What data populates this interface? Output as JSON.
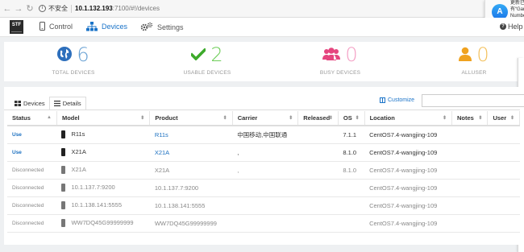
{
  "browser": {
    "info": "i",
    "insecure_label": "不安全",
    "host": "10.1.132.193",
    "path": ":7100/#!/devices"
  },
  "notification": {
    "lines": [
      "更新已",
      "有“Gar",
      "Numbe"
    ]
  },
  "header": {
    "logo": "STF",
    "nav": {
      "control": "Control",
      "devices": "Devices",
      "settings": "Settings"
    },
    "help": "Help"
  },
  "stats": {
    "total": {
      "value": "6",
      "label": "TOTAL DEVICES"
    },
    "usable": {
      "value": "2",
      "label": "USABLE DEVICES"
    },
    "busy": {
      "value": "0",
      "label": "BUSY DEVICES"
    },
    "alluser": {
      "value": "0",
      "label": "ALLUSER"
    }
  },
  "device_panel": {
    "tabs": {
      "devices": "Devices",
      "details": "Details"
    },
    "customize": "Customize",
    "search_placeholder": ""
  },
  "table": {
    "columns": [
      "Status",
      "Model",
      "Product",
      "Carrier",
      "Released",
      "OS",
      "Location",
      "Notes",
      "User"
    ],
    "rows": [
      {
        "status": "Use",
        "model": "R11s",
        "product": "R11s",
        "carrier": "中国移动,中国联通",
        "released": "",
        "os": "7.1.1",
        "location": "CentOS7.4-wangjing-109",
        "notes": "",
        "user": ""
      },
      {
        "status": "Use",
        "model": "X21A",
        "product": "X21A",
        "carrier": ",",
        "released": "",
        "os": "8.1.0",
        "location": "CentOS7.4-wangjing-109",
        "notes": "",
        "user": ""
      },
      {
        "status": "Disconnected",
        "model": "X21A",
        "product": "X21A",
        "carrier": ",",
        "released": "",
        "os": "8.1.0",
        "location": "CentOS7.4-wangjing-109",
        "notes": "",
        "user": ""
      },
      {
        "status": "Disconnected",
        "model": "10.1.137.7:9200",
        "product": "10.1.137.7:9200",
        "carrier": "",
        "released": "",
        "os": "",
        "location": "CentOS7.4-wangjing-109",
        "notes": "",
        "user": ""
      },
      {
        "status": "Disconnected",
        "model": "10.1.138.141:5555",
        "product": "10.1.138.141:5555",
        "carrier": "",
        "released": "",
        "os": "",
        "location": "CentOS7.4-wangjing-109",
        "notes": "",
        "user": ""
      },
      {
        "status": "Disconnected",
        "model": "WW7DQ45G99999999",
        "product": "WW7DQ45G99999999",
        "carrier": "",
        "released": "",
        "os": "",
        "location": "CentOS7.4-wangjing-109",
        "notes": "",
        "user": ""
      }
    ]
  },
  "colors": {
    "accent": "#1a73c8",
    "total": "#6aa2d4",
    "usable": "#6fce5a",
    "busy": "#f49ec4",
    "alluser": "#f3c05b"
  },
  "icons": {
    "back": "arrow-left-icon",
    "forward": "arrow-right-icon",
    "reload": "reload-icon",
    "control": "phone-icon",
    "devices": "sitemap-icon",
    "settings": "gears-icon",
    "total": "globe-icon",
    "usable": "check-icon",
    "busy": "users-icon",
    "alluser": "user-icon"
  }
}
